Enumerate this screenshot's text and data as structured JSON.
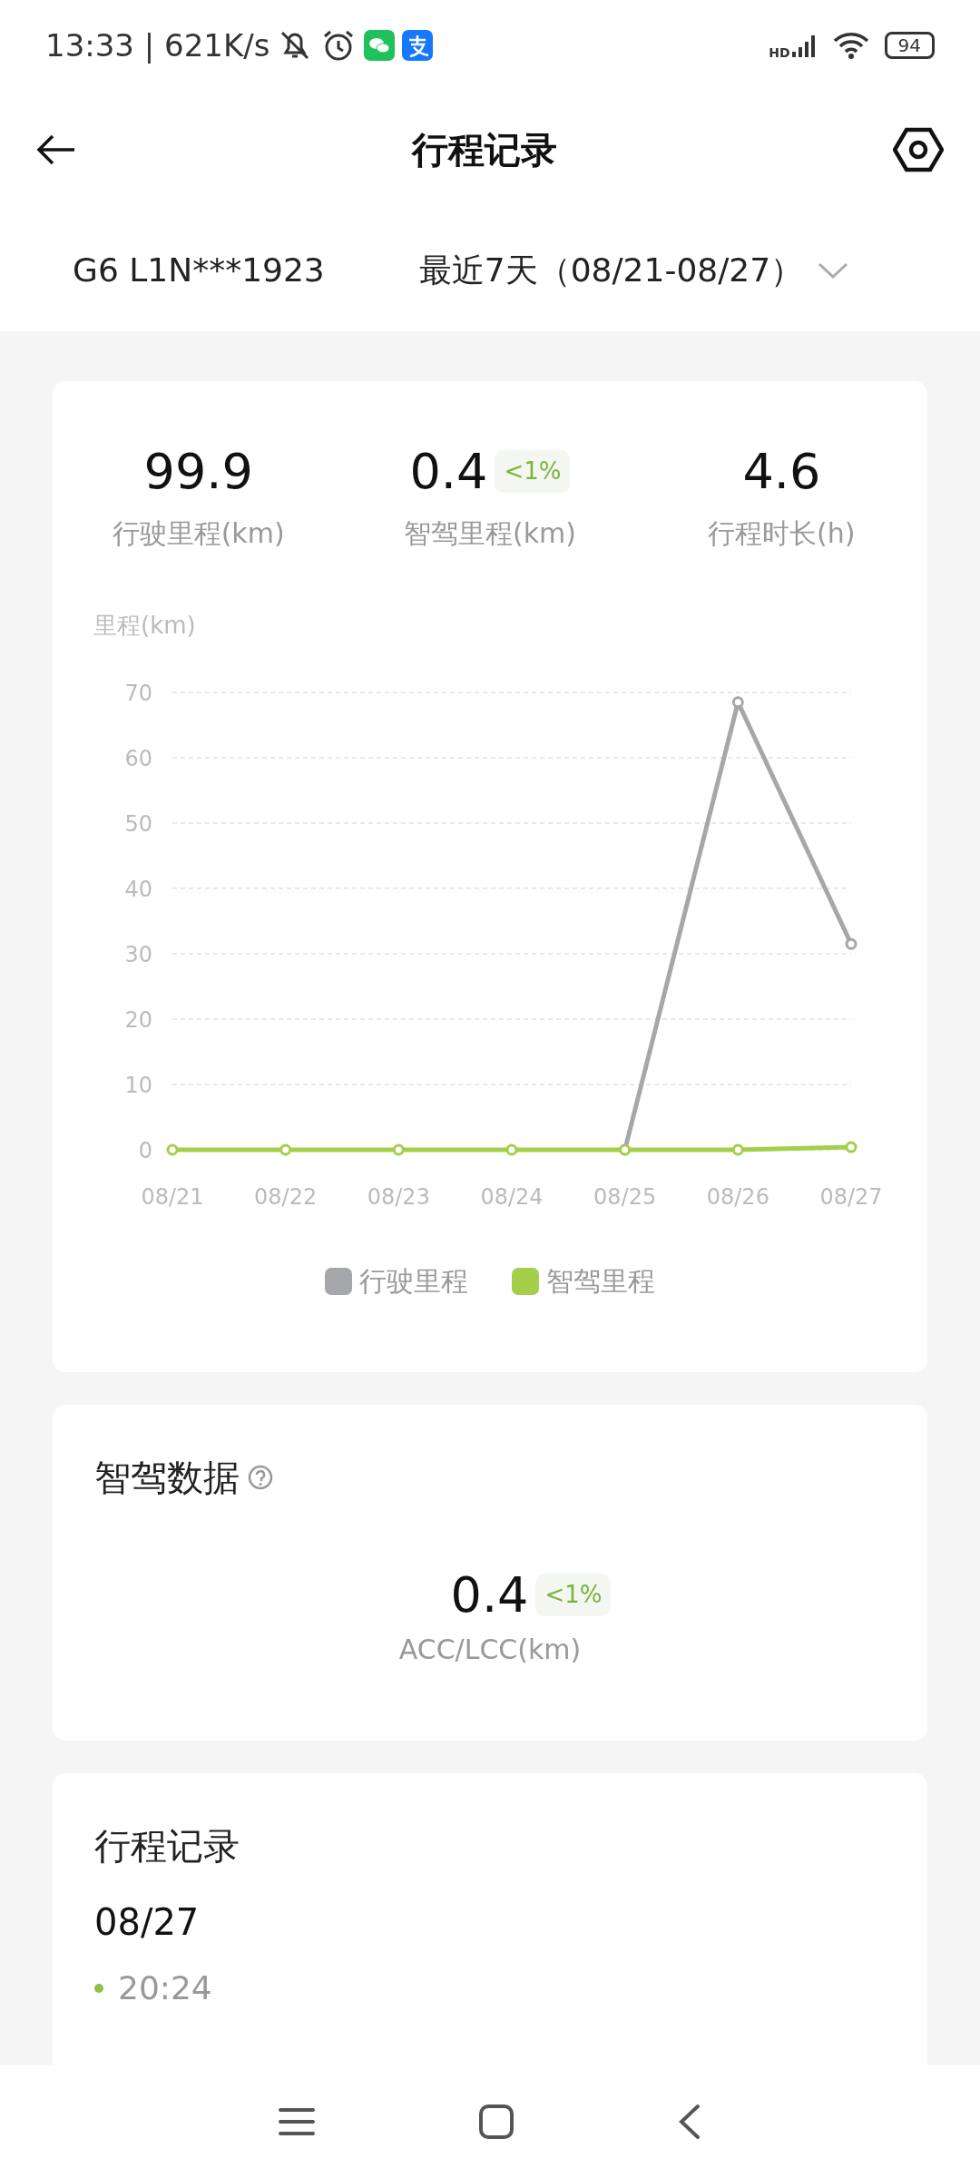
{
  "status_bar": {
    "time_speed": "13:33 | 621K/s",
    "network": "HD",
    "battery": "94"
  },
  "header": {
    "title": "行程记录"
  },
  "selector": {
    "vehicle": "G6 L1N***1923",
    "period": "最近7天（08/21-08/27）"
  },
  "summary": {
    "stats": [
      {
        "value": "99.9",
        "label": "行驶里程(km)"
      },
      {
        "value": "0.4",
        "badge": "<1%",
        "label": "智驾里程(km)"
      },
      {
        "value": "4.6",
        "label": "行程时长(h)"
      }
    ],
    "chart_data": {
      "type": "line",
      "ylabel": "里程(km)",
      "categories": [
        "08/21",
        "08/22",
        "08/23",
        "08/24",
        "08/25",
        "08/26",
        "08/27"
      ],
      "series": [
        {
          "name": "行驶里程",
          "color": "#a6a7ab",
          "marker": "circle",
          "values": [
            null,
            null,
            null,
            null,
            0,
            68.5,
            31.5
          ]
        },
        {
          "name": "智驾里程",
          "color": "#a3cf4a",
          "marker": "circle",
          "values": [
            0,
            0,
            0,
            0,
            0,
            0,
            0.4
          ]
        }
      ],
      "grid": true,
      "ylim": [
        0,
        70
      ],
      "yticks": [
        0,
        10,
        20,
        30,
        40,
        50,
        60,
        70
      ]
    }
  },
  "assist": {
    "title": "智驾数据",
    "value": "0.4",
    "badge": "<1%",
    "label": "ACC/LCC(km)"
  },
  "trips": {
    "title": "行程记录",
    "groups": [
      {
        "date": "08/27",
        "items": [
          {
            "time": "20:24"
          }
        ]
      }
    ]
  }
}
